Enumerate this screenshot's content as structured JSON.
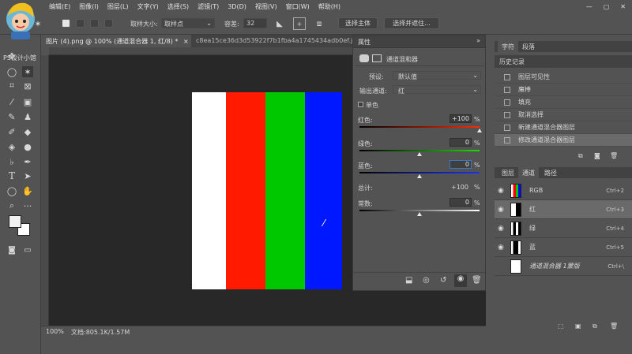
{
  "menu": [
    "编辑(E)",
    "图像(I)",
    "图层(L)",
    "文字(Y)",
    "选择(S)",
    "滤镜(T)",
    "3D(D)",
    "视图(V)",
    "窗口(W)",
    "帮助(H)"
  ],
  "options": {
    "sample_size_label": "取样大小:",
    "sample_size_value": "取样点",
    "tolerance_label": "容差:",
    "tolerance_value": "32",
    "select_subject": "选择主体",
    "select_and_mask": "选择并遮住..."
  },
  "tabs": [
    {
      "label": "图片 (4).png @ 100% (通道混合器 1, 红/8) *",
      "close": "×"
    },
    {
      "label": "c8ea15ce36d3d53922f7b1fba4a1745434adb0ef.jpeg @ ...",
      "close": "×"
    }
  ],
  "watermark": "PS设计小馆",
  "properties": {
    "title": "属性",
    "panel_name": "通道混和器",
    "preset_label": "预设:",
    "preset_value": "默认值",
    "output_label": "输出通道:",
    "output_value": "红",
    "mono_label": "单色",
    "red_label": "红色:",
    "red_value": "+100",
    "green_label": "绿色:",
    "green_value": "0",
    "blue_label": "蓝色:",
    "blue_value": "0",
    "total_label": "总计:",
    "total_value": "+100",
    "const_label": "常数:",
    "const_value": "0",
    "pct": "%",
    "red_level": 1.0,
    "green_level": 0.5,
    "blue_level": 0.5,
    "const_level": 0.5
  },
  "status": {
    "zoom": "100%",
    "doc": "文档:805.1K/1.57M"
  },
  "right_tabs_top": [
    "字符",
    "段落"
  ],
  "history": {
    "title": "历史记录",
    "items": [
      "图层可见性",
      "魔棒",
      "填充",
      "取消选择",
      "新建通道混合器图层",
      "修改通道混合器图层"
    ]
  },
  "channel_tabs": [
    "图层",
    "通道",
    "路径"
  ],
  "channels": [
    {
      "name": "RGB",
      "shortcut": "Ctrl+2"
    },
    {
      "name": "红",
      "shortcut": "Ctrl+3"
    },
    {
      "name": "绿",
      "shortcut": "Ctrl+4"
    },
    {
      "name": "蓝",
      "shortcut": "Ctrl+5"
    },
    {
      "name": "通道混合器 1蒙版",
      "shortcut": "Ctrl+\\"
    }
  ],
  "colors": {
    "red": "#ff1a00",
    "green": "#00c800",
    "blue": "#0018ff",
    "bg": "#535353",
    "canvas": "#282828"
  }
}
